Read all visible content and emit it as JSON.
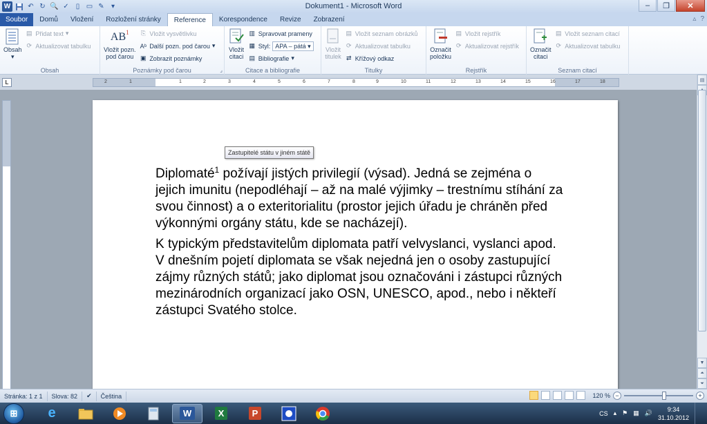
{
  "window": {
    "title": "Dokument1 - Microsoft Word",
    "app_logo": "W"
  },
  "tabs": [
    {
      "label": "Soubor"
    },
    {
      "label": "Domů"
    },
    {
      "label": "Vložení"
    },
    {
      "label": "Rozložení stránky"
    },
    {
      "label": "Reference"
    },
    {
      "label": "Korespondence"
    },
    {
      "label": "Revize"
    },
    {
      "label": "Zobrazení"
    }
  ],
  "active_tab": "Reference",
  "ribbon": {
    "obsah": {
      "group_label": "Obsah",
      "big_button": "Obsah",
      "add_text": "Přidat text",
      "update_table": "Aktualizovat tabulku"
    },
    "poznamky": {
      "group_label": "Poznámky pod čarou",
      "insert_footnote_line1": "Vložit pozn.",
      "insert_footnote_line2": "pod čarou",
      "insert_endnote": "Vložit vysvětlivku",
      "next_footnote": "Další pozn. pod čarou",
      "show_notes": "Zobrazit poznámky"
    },
    "citace": {
      "group_label": "Citace a bibliografie",
      "insert_citation_line1": "Vložit",
      "insert_citation_line2": "citaci",
      "manage_sources": "Spravovat prameny",
      "style_label": "Styl:",
      "style_value": "APA – pátá",
      "bibliography": "Bibliografie"
    },
    "titulky": {
      "group_label": "Titulky",
      "insert_caption_line1": "Vložit",
      "insert_caption_line2": "titulek",
      "insert_table_of_figures": "Vložit seznam obrázků",
      "update_table": "Aktualizovat tabulku",
      "cross_reference": "Křížový odkaz"
    },
    "rejstrik": {
      "group_label": "Rejstřík",
      "mark_entry_line1": "Označit",
      "mark_entry_line2": "položku",
      "insert_index": "Vložit rejstřík",
      "update_index": "Aktualizovat rejstřík"
    },
    "seznam_citaci": {
      "group_label": "Seznam citací",
      "mark_citation_line1": "Označit",
      "mark_citation_line2": "citaci",
      "insert_table_of_authorities": "Vložit seznam citací",
      "update_table": "Aktualizovat tabulku"
    }
  },
  "ruler": {
    "corner": "L",
    "ticks": [
      "2",
      "1",
      "1",
      "2",
      "3",
      "4",
      "5",
      "6",
      "7",
      "8",
      "9",
      "10",
      "11",
      "12",
      "13",
      "14",
      "15",
      "16",
      "17",
      "18"
    ]
  },
  "document": {
    "tooltip": "Zastupitelé státu v jiném státě",
    "p1_before": "Diplomaté",
    "p1_sup": "1",
    "p1_after": " požívají jistých privilegií (výsad). Jedná se zejména o jejich imunitu (nepodléhají – až na malé výjimky – trestnímu stíhání za svou činnost) a o exteritorialitu (prostor jejich úřadu je chráněn před výkonnými orgány státu, kde se nacházejí).",
    "p2": "K typickým představitelům diplomata patří velvyslanci, vyslanci apod. V dnešním pojetí diplomata se však nejedná jen o osoby zastupující zájmy různých států; jako diplomat jsou označováni i zástupci různých mezinárodních organizací jako OSN, UNESCO, apod., nebo i někteří zástupci Svatého stolce."
  },
  "statusbar": {
    "page": "Stránka: 1 z 1",
    "words": "Slova: 82",
    "language": "Čeština",
    "zoom": "120 %"
  },
  "taskbar": {
    "language": "CS",
    "time": "9:34",
    "date": "31.10.2012"
  }
}
